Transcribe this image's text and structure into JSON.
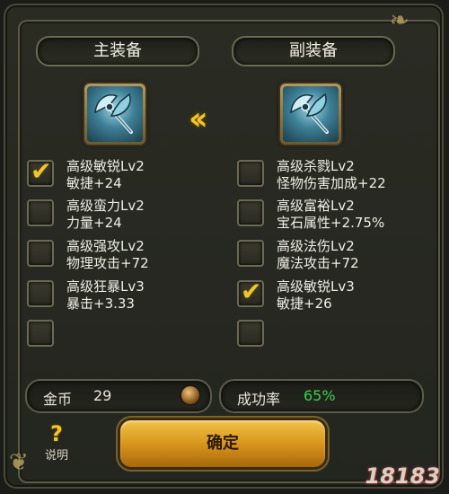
{
  "header": {
    "main": "主装备",
    "sub": "副装备"
  },
  "left_options": [
    {
      "line1": "高级敏锐Lv2",
      "line2": "敏捷+24",
      "checked": true
    },
    {
      "line1": "高级蛮力Lv2",
      "line2": "力量+24",
      "checked": false
    },
    {
      "line1": "高级强攻Lv2",
      "line2": "物理攻击+72",
      "checked": false
    },
    {
      "line1": "高级狂暴Lv3",
      "line2": "暴击+3.33",
      "checked": false
    },
    {
      "line1": "",
      "line2": "",
      "checked": false
    }
  ],
  "right_options": [
    {
      "line1": "高级杀戮Lv2",
      "line2": "怪物伤害加成+22",
      "checked": false
    },
    {
      "line1": "高级富裕Lv2",
      "line2": "宝石属性+2.75%",
      "checked": false
    },
    {
      "line1": "高级法伤Lv2",
      "line2": "魔法攻击+72",
      "checked": false
    },
    {
      "line1": "高级敏锐Lv3",
      "line2": "敏捷+26",
      "checked": true
    },
    {
      "line1": "",
      "line2": "",
      "checked": false
    }
  ],
  "gold": {
    "label": "金币",
    "value": "29"
  },
  "success": {
    "label": "成功率",
    "value": "65%"
  },
  "help_label": "说明",
  "confirm_label": "确定",
  "watermark": "18183",
  "colors": {
    "accent": "#f0c430",
    "success": "#39d24a",
    "button": "#e2a52a"
  },
  "icons": {
    "arrow": "double-chevron-left-icon",
    "weapon": "axe-icon",
    "coin": "coin-icon"
  }
}
